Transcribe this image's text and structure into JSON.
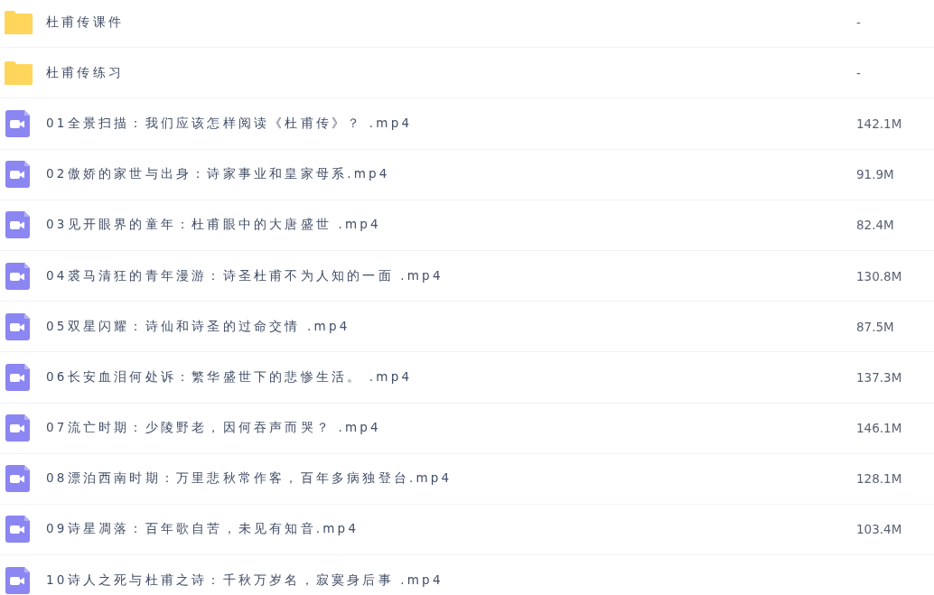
{
  "files": [
    {
      "kind": "folder",
      "name": "杜甫传课件",
      "size": "-"
    },
    {
      "kind": "folder",
      "name": "杜甫传练习",
      "size": "-"
    },
    {
      "kind": "video",
      "name": "01全景扫描：我们应该怎样阅读《杜甫传》？ .mp4",
      "size": "142.1M"
    },
    {
      "kind": "video",
      "name": "02傲娇的家世与出身：诗家事业和皇家母系.mp4",
      "size": "91.9M"
    },
    {
      "kind": "video",
      "name": "03见开眼界的童年：杜甫眼中的大唐盛世 .mp4",
      "size": "82.4M"
    },
    {
      "kind": "video",
      "name": "04裘马清狂的青年漫游：诗圣杜甫不为人知的一面 .mp4",
      "size": "130.8M"
    },
    {
      "kind": "video",
      "name": "05双星闪耀：诗仙和诗圣的过命交情 .mp4",
      "size": "87.5M"
    },
    {
      "kind": "video",
      "name": "06长安血泪何处诉：繁华盛世下的悲惨生活。 .mp4",
      "size": "137.3M"
    },
    {
      "kind": "video",
      "name": "07流亡时期：少陵野老，因何吞声而哭？ .mp4",
      "size": "146.1M"
    },
    {
      "kind": "video",
      "name": "08漂泊西南时期：万里悲秋常作客，百年多病独登台.mp4",
      "size": "128.1M"
    },
    {
      "kind": "video",
      "name": "09诗星凋落：百年歌自苦，未见有知音.mp4",
      "size": "103.4M"
    },
    {
      "kind": "video",
      "name": "10诗人之死与杜甫之诗：千秋万岁名，寂寞身后事 .mp4"
    }
  ]
}
